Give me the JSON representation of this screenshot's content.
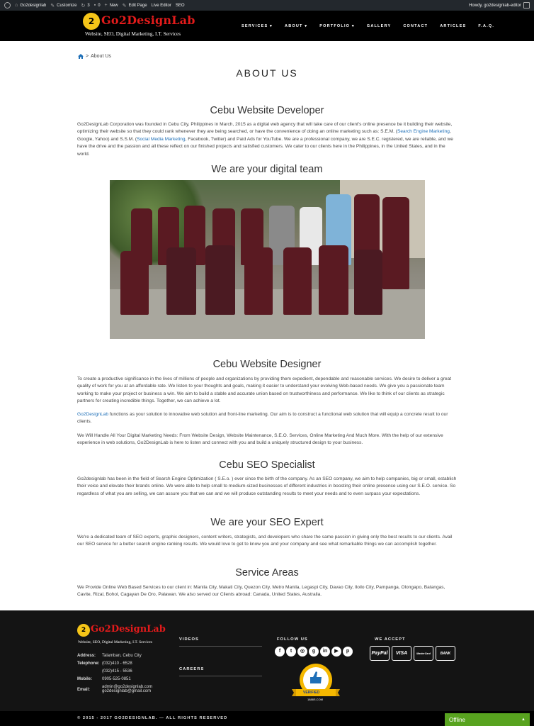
{
  "adminbar": {
    "site_name": "Go2designlab",
    "customize": "Customize",
    "updates": "3",
    "comments": "0",
    "new": "New",
    "edit_page": "Edit Page",
    "live_editor": "Live Editor",
    "seo": "SEO",
    "howdy": "Howdy, go2designlab-editor"
  },
  "header": {
    "logo_mark": "2",
    "logo_name": "Go2DesignLab",
    "logo_tagline": "Website, SEO, Digital Marketing, I.T. Services",
    "nav": [
      "SERVICES ▾",
      "ABOUT ▾",
      "PORTFOLIO ▾",
      "GALLERY",
      "CONTACT",
      "ARTICLES",
      "F.A.Q."
    ]
  },
  "breadcrumb": {
    "sep": ">",
    "current": "About Us"
  },
  "page_title": "ABOUT US",
  "sections": {
    "s1_title": "Cebu Website Developer",
    "s1_text_a": "Go2DesignLab Corporation was founded in Cebu City, Philippines in March, 2015 as a digital web agency that will take care of our client's online presence be it building their website, optimizing their website so that they could rank whenever they are being searched, or have the convenience of doing an online marketing such as: S.E.M. (",
    "s1_link1": "Search Engine Marketing",
    "s1_text_b": ", Google, Yahoo) and S.S.M. (",
    "s1_link2": "Social Media Marketing",
    "s1_text_c": ", Facebook, Twitter) and Paid Ads for YouTube. We are a professional company, we are S.E.C. registered, we are reliable, and we have the drive and the passion and all these reflect on our finished projects and satisfied customers. We cater to our clients here in the Philippines, in the United States, and in the world.",
    "s2_title": "We are your digital team",
    "s3_title": "Cebu Website Designer",
    "s3_p1": "To create a productive significance in the lives of millions of people and organizations by providing them expedient, dependable and reasonable services. We desire to deliver a great quality of work for you at an affordable rate. We listen to your thoughts and goals, making it easier to understand your evolving Web-based needs. We give you a passionate team working to make your project or business a win. We aim to build a stable and accurate union based on trustworthiness and performance. We like to think of our clients as strategic partners for creating incredible things. Together, we can achieve a lot.",
    "s3_p2_link": "Go2DesignLab",
    "s3_p2": " functions as your solution to innovative web solution and front-line marketing. Our aim is to construct a functional web solution that will equip a concrete result to our clients.",
    "s3_p3": "We Will Handle All Your Digital Marketing Needs: From Website Design, Website Maintenance, S.E.O. Services, Online Marketing And Much More. With the help of our extensive experience in web solutions, Go2DesignLab is here to listen and connect with you and build a uniquely structured design to your business.",
    "s4_title": "Cebu SEO Specialist",
    "s4_p": "Go2designlab has been in the field of Search Engine Optimization ( S.E.o. ) ever since the birth of the company. As an SEO company, we aim to help companies, big or small, establish their voice and elevate their brands online. We were able to help small to medium-sized businesses of different industries in boosting their online presence using our S.E.O. service. So regardless of what you are selling, we can assure you that we can and we will produce outstanding results to meet your needs and to even surpass your expectations.",
    "s5_title": "We are your SEO Expert",
    "s5_p": "We're a dedicated team of SEO experts, graphic designers, content writers, strategists, and developers who share the same passion in giving only the best results to our clients. Avail our SEO service for a better search engine ranking results. We would love to get to know you and your company and see what remarkable things we can accomplish together.",
    "s6_title": "Service Areas",
    "s6_p": "We Provide Online Web Based Services to our client in: Manila City, Makati City, Quezon City, Metro Manila, Legaspi City, Davao City, Iloilo City, Pampanga, Olongapo, Batangas, Cavite, Rizal, Bohol, Cagayan De Oro, Palawan. We also served our Clients abroad: Canada, United States, Australia."
  },
  "footer": {
    "logo_mark": "2",
    "logo_name": "Go2DesignLab",
    "logo_tagline": "Website, SEO, Digital Marketing, I.T. Services",
    "address_label": "Address:",
    "address": "Talamban, Cebu City",
    "telephone_label": "Telephone:",
    "telephone1": "(032)410 - 6528",
    "telephone2": "(032)415 - 5536",
    "mobile_label": "Mobile:",
    "mobile": "0905-525-0851",
    "email_label": "Email:",
    "email1": "admin@go2designlab.com",
    "email2": "go2designlab@gmail.com",
    "videos": "VIDEOS",
    "careers": "CAREERS",
    "follow_us": "FOLLOW US",
    "we_accept": "WE ACCEPT",
    "cards": [
      "PayPal",
      "VISA",
      "MasterCard",
      "BANK"
    ],
    "badge_top": "VERIFIED",
    "badge_bottom": "1888S.COM",
    "copyright": "© 2015 - 2017 GO2DESIGNLAB. — ALL RIGHTS RESERVED"
  },
  "chat": {
    "status": "Offline",
    "toggle": "▲"
  },
  "colors": {
    "header_bg": "#000000",
    "logo_red": "#e31b1b",
    "logo_gold": "#f5c518",
    "link": "#1e6fb7",
    "footer_bg": "#141414",
    "chat_green": "#58a31f"
  }
}
